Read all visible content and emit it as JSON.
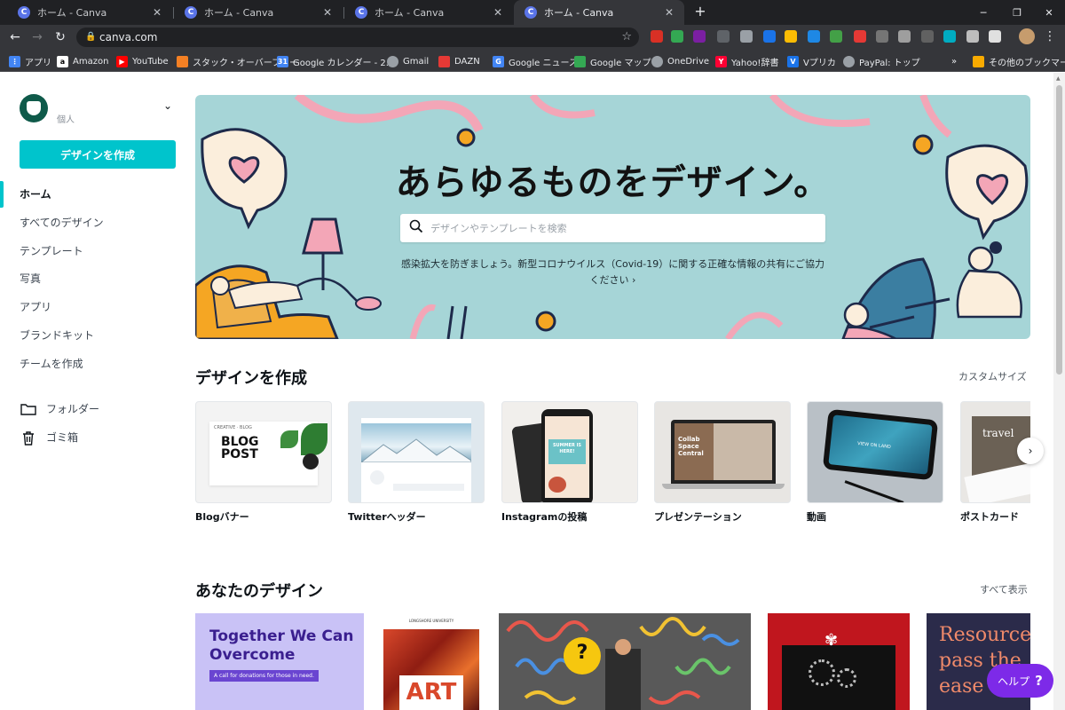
{
  "browser": {
    "tabs": [
      {
        "title": "ホーム - Canva",
        "favicon": "C"
      },
      {
        "title": "ホーム - Canva",
        "favicon": "C"
      },
      {
        "title": "ホーム - Canva",
        "favicon": "C"
      },
      {
        "title": "ホーム - Canva",
        "favicon": "C"
      }
    ],
    "url": "canva.com",
    "bookmarks": [
      {
        "label": "アプリ",
        "color": "#4285f4"
      },
      {
        "label": "Amazon",
        "color": "#ffffff"
      },
      {
        "label": "YouTube",
        "color": "#ff0000"
      },
      {
        "label": "スタック・オーバーフロー",
        "color": "#f48024"
      },
      {
        "label": "Google カレンダー - 2...",
        "color": "#4285f4"
      },
      {
        "label": "Gmail",
        "color": "#9aa0a6"
      },
      {
        "label": "DAZN",
        "color": "#e53935"
      },
      {
        "label": "Google ニュース",
        "color": "#4285f4"
      },
      {
        "label": "Google マップ",
        "color": "#34a853"
      },
      {
        "label": "OneDrive",
        "color": "#9aa0a6"
      },
      {
        "label": "Yahoo!辞書",
        "color": "#ff0033"
      },
      {
        "label": "Vプリカ",
        "color": "#1a73e8"
      },
      {
        "label": "PayPal: トップ",
        "color": "#9aa0a6"
      }
    ],
    "bookmarks_more": "»",
    "other_bookmarks": "その他のブックマーク"
  },
  "sidebar": {
    "account_type": "個人",
    "create_button": "デザインを作成",
    "nav": [
      {
        "label": "ホーム"
      },
      {
        "label": "すべてのデザイン"
      },
      {
        "label": "テンプレート"
      },
      {
        "label": "写真"
      },
      {
        "label": "アプリ"
      },
      {
        "label": "ブランドキット"
      },
      {
        "label": "チームを作成"
      }
    ],
    "folders_label": "フォルダー",
    "trash_label": "ゴミ箱"
  },
  "hero": {
    "title": "あらゆるものをデザイン。",
    "search_placeholder": "デザインやテンプレートを検索",
    "note": "感染拡大を防ぎましょう。新型コロナウイルス（Covid-19）に関する正確な情報の共有にご協力ください ›"
  },
  "create_section": {
    "title": "デザインを作成",
    "custom_size": "カスタムサイズ",
    "cards": [
      {
        "label": "Blogバナー",
        "thumb_text": "BLOG POST",
        "thumb_top": "CREATIVE  ·  BLOG"
      },
      {
        "label": "Twitterヘッダー"
      },
      {
        "label": "Instagramの投稿",
        "thumb_text": "SUMMER IS HERE!"
      },
      {
        "label": "プレゼンテーション",
        "thumb_text": "Collab Space Central"
      },
      {
        "label": "動画",
        "thumb_text": "VIEW ON LAND"
      },
      {
        "label": "ポストカード",
        "thumb_text": "travel"
      }
    ]
  },
  "your_designs": {
    "title": "あなたのデザイン",
    "show_all": "すべて表示",
    "cards": [
      {
        "title": "Together We Can Overcome",
        "subtitle": "A call for donations for those in need."
      },
      {
        "title": "ART",
        "subtitle": "LONGSHORE UNIVERSITY"
      },
      {
        "title": "?"
      },
      {
        "title": ""
      },
      {
        "title": "Resource pass the ease"
      }
    ]
  },
  "help_button": {
    "label": "ヘルプ",
    "icon": "?"
  },
  "colors": {
    "accent": "#00c4cc",
    "help": "#7d2ae8",
    "hero_bg": "#a6d5d7"
  }
}
